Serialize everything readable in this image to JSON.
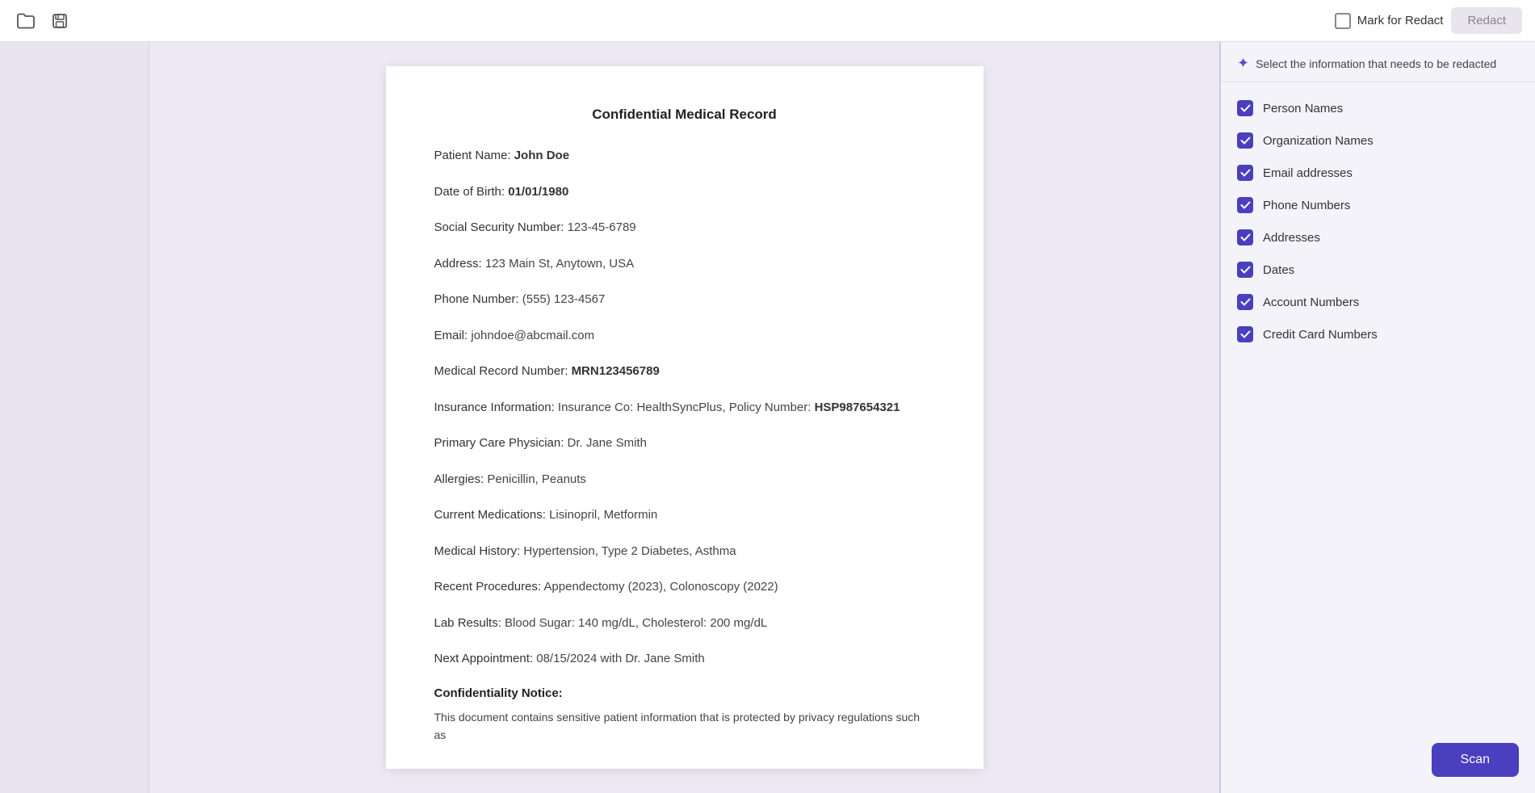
{
  "toolbar": {
    "folder_icon": "📁",
    "save_icon": "💾",
    "mark_for_redact_label": "Mark for Redact",
    "redact_button_label": "Redact"
  },
  "panel": {
    "header_text": "Select the information that needs to be redacted",
    "checklist": [
      {
        "id": "person-names",
        "label": "Person Names",
        "checked": true
      },
      {
        "id": "organization-names",
        "label": "Organization Names",
        "checked": true
      },
      {
        "id": "email-addresses",
        "label": "Email addresses",
        "checked": true
      },
      {
        "id": "phone-numbers",
        "label": "Phone Numbers",
        "checked": true
      },
      {
        "id": "addresses",
        "label": "Addresses",
        "checked": true
      },
      {
        "id": "dates",
        "label": "Dates",
        "checked": true
      },
      {
        "id": "account-numbers",
        "label": "Account Numbers",
        "checked": true
      },
      {
        "id": "credit-card-numbers",
        "label": "Credit Card Numbers",
        "checked": true
      }
    ],
    "scan_button_label": "Scan"
  },
  "document": {
    "title": "Confidential Medical Record",
    "fields": [
      {
        "label": "Patient Name: ",
        "value": "John Doe",
        "bold_value": true
      },
      {
        "label": "Date of Birth: ",
        "value": "01/01/1980",
        "bold_value": true
      },
      {
        "label": "Social Security Number: ",
        "value": "123-45-6789",
        "bold_value": false
      },
      {
        "label": "Address: ",
        "value": "123 Main St, Anytown, USA",
        "bold_value": false
      },
      {
        "label": "Phone Number: ",
        "value": "(555) 123-4567",
        "bold_value": false
      },
      {
        "label": "Email: ",
        "value": "johndoe@abcmail.com",
        "bold_value": false
      },
      {
        "label": "Medical Record Number: ",
        "value": "MRN123456789",
        "bold_value": true
      },
      {
        "label": "Insurance Information: ",
        "value": "Insurance Co: HealthSyncPlus, Policy Number: ",
        "extra_bold": "HSP987654321",
        "bold_value": false
      },
      {
        "label": "Primary Care Physician: ",
        "value": "Dr. Jane Smith",
        "bold_value": false
      },
      {
        "label": "Allergies: ",
        "value": "Penicillin, Peanuts",
        "bold_value": false
      },
      {
        "label": "Current Medications: ",
        "value": "Lisinopril, Metformin",
        "bold_value": false
      },
      {
        "label": "Medical History: ",
        "value": "Hypertension, Type 2 Diabetes, Asthma",
        "bold_value": false
      },
      {
        "label": "Recent Procedures: ",
        "value": "Appendectomy (2023), Colonoscopy (2022)",
        "bold_value": false
      },
      {
        "label": "Lab Results: ",
        "value": "Blood Sugar: 140 mg/dL, Cholesterol: 200 mg/dL",
        "bold_value": false
      },
      {
        "label": "Next Appointment: ",
        "value": "08/15/2024 with Dr. Jane Smith",
        "bold_value": false
      }
    ],
    "confidentiality_title": "Confidentiality Notice:",
    "confidentiality_text": "This document contains sensitive patient information that is protected by privacy regulations such as"
  }
}
